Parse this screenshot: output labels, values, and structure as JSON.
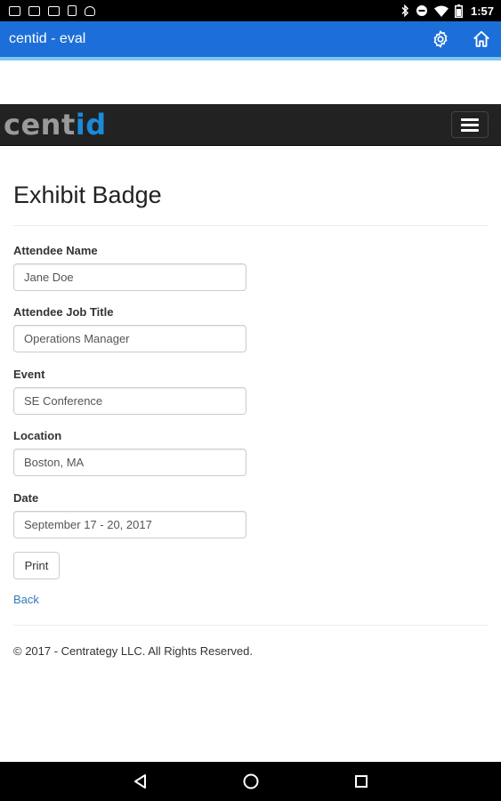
{
  "status_bar": {
    "time": "1:57",
    "left_icons": [
      "image-icon",
      "message-icon",
      "message-icon",
      "sim-icon",
      "android-icon"
    ],
    "right_icons": [
      "bluetooth-icon",
      "do-not-disturb-icon",
      "wifi-icon",
      "battery-icon"
    ]
  },
  "app_bar": {
    "title": "centid - eval",
    "icons": [
      "settings-icon",
      "home-icon"
    ],
    "color": "#1c6fd9",
    "strip_color": "#7ec8ee"
  },
  "navbar": {
    "brand_part1": "cent",
    "brand_part2": "id",
    "brand_color1": "#9a9a9a",
    "brand_color2": "#1a8ad9",
    "background": "#222222"
  },
  "page": {
    "title": "Exhibit Badge",
    "fields": [
      {
        "label": "Attendee Name",
        "value": "Jane Doe"
      },
      {
        "label": "Attendee Job Title",
        "value": "Operations Manager"
      },
      {
        "label": "Event",
        "value": "SE Conference"
      },
      {
        "label": "Location",
        "value": "Boston, MA"
      },
      {
        "label": "Date",
        "value": "September 17 - 20, 2017"
      }
    ],
    "print_label": "Print",
    "back_label": "Back",
    "footer": "© 2017 - Centrategy LLC. All Rights Reserved.",
    "link_color": "#337ab7"
  },
  "system_nav": {
    "buttons": [
      "back-icon",
      "home-circle-icon",
      "recents-icon"
    ]
  }
}
